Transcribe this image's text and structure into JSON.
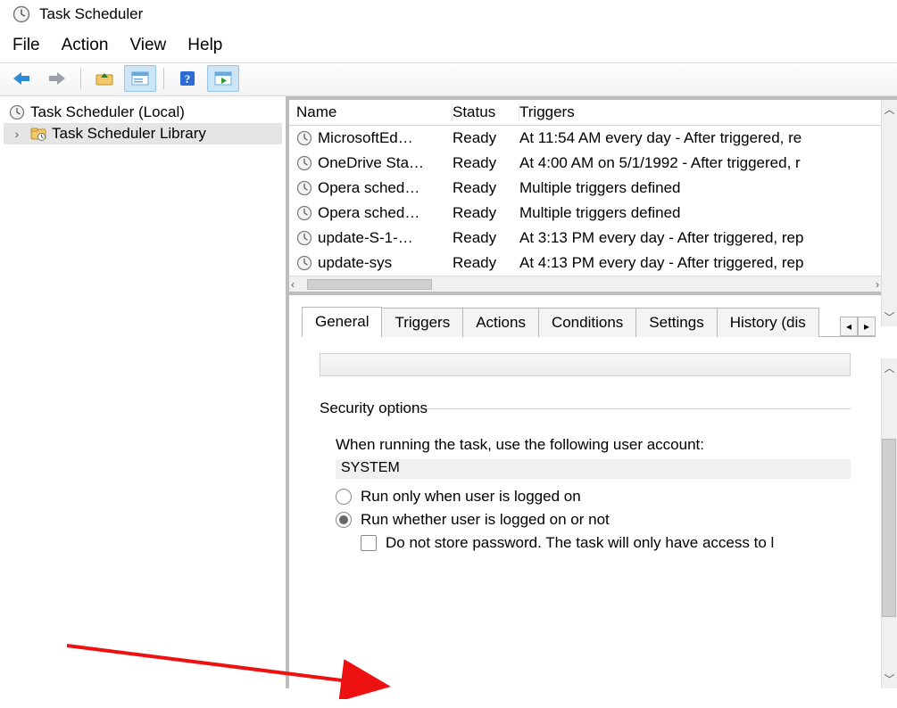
{
  "window": {
    "title": "Task Scheduler"
  },
  "menu": {
    "file": "File",
    "action": "Action",
    "view": "View",
    "help": "Help"
  },
  "tree": {
    "root": "Task Scheduler (Local)",
    "library": "Task Scheduler Library"
  },
  "task_list": {
    "columns": {
      "name": "Name",
      "status": "Status",
      "triggers": "Triggers"
    },
    "rows": [
      {
        "name": "MicrosoftEd…",
        "status": "Ready",
        "triggers": "At 11:54 AM every day - After triggered, re"
      },
      {
        "name": "OneDrive Sta…",
        "status": "Ready",
        "triggers": "At 4:00 AM on 5/1/1992 - After triggered, r"
      },
      {
        "name": "Opera sched…",
        "status": "Ready",
        "triggers": "Multiple triggers defined"
      },
      {
        "name": "Opera sched…",
        "status": "Ready",
        "triggers": "Multiple triggers defined"
      },
      {
        "name": "update-S-1-…",
        "status": "Ready",
        "triggers": "At 3:13 PM every day - After triggered, rep"
      },
      {
        "name": "update-sys",
        "status": "Ready",
        "triggers": "At 4:13 PM every day - After triggered, rep"
      }
    ]
  },
  "tabs": {
    "general": "General",
    "triggers": "Triggers",
    "actions": "Actions",
    "conditions": "Conditions",
    "settings": "Settings",
    "history": "History (dis"
  },
  "details": {
    "group_label": "Security options",
    "run_as_label": "When running the task, use the following user account:",
    "account": "SYSTEM",
    "opt_logged_on": "Run only when user is logged on",
    "opt_logged_on_or_not": "Run whether user is logged on or not",
    "opt_no_password": "Do not store password.  The task will only have access to l"
  }
}
